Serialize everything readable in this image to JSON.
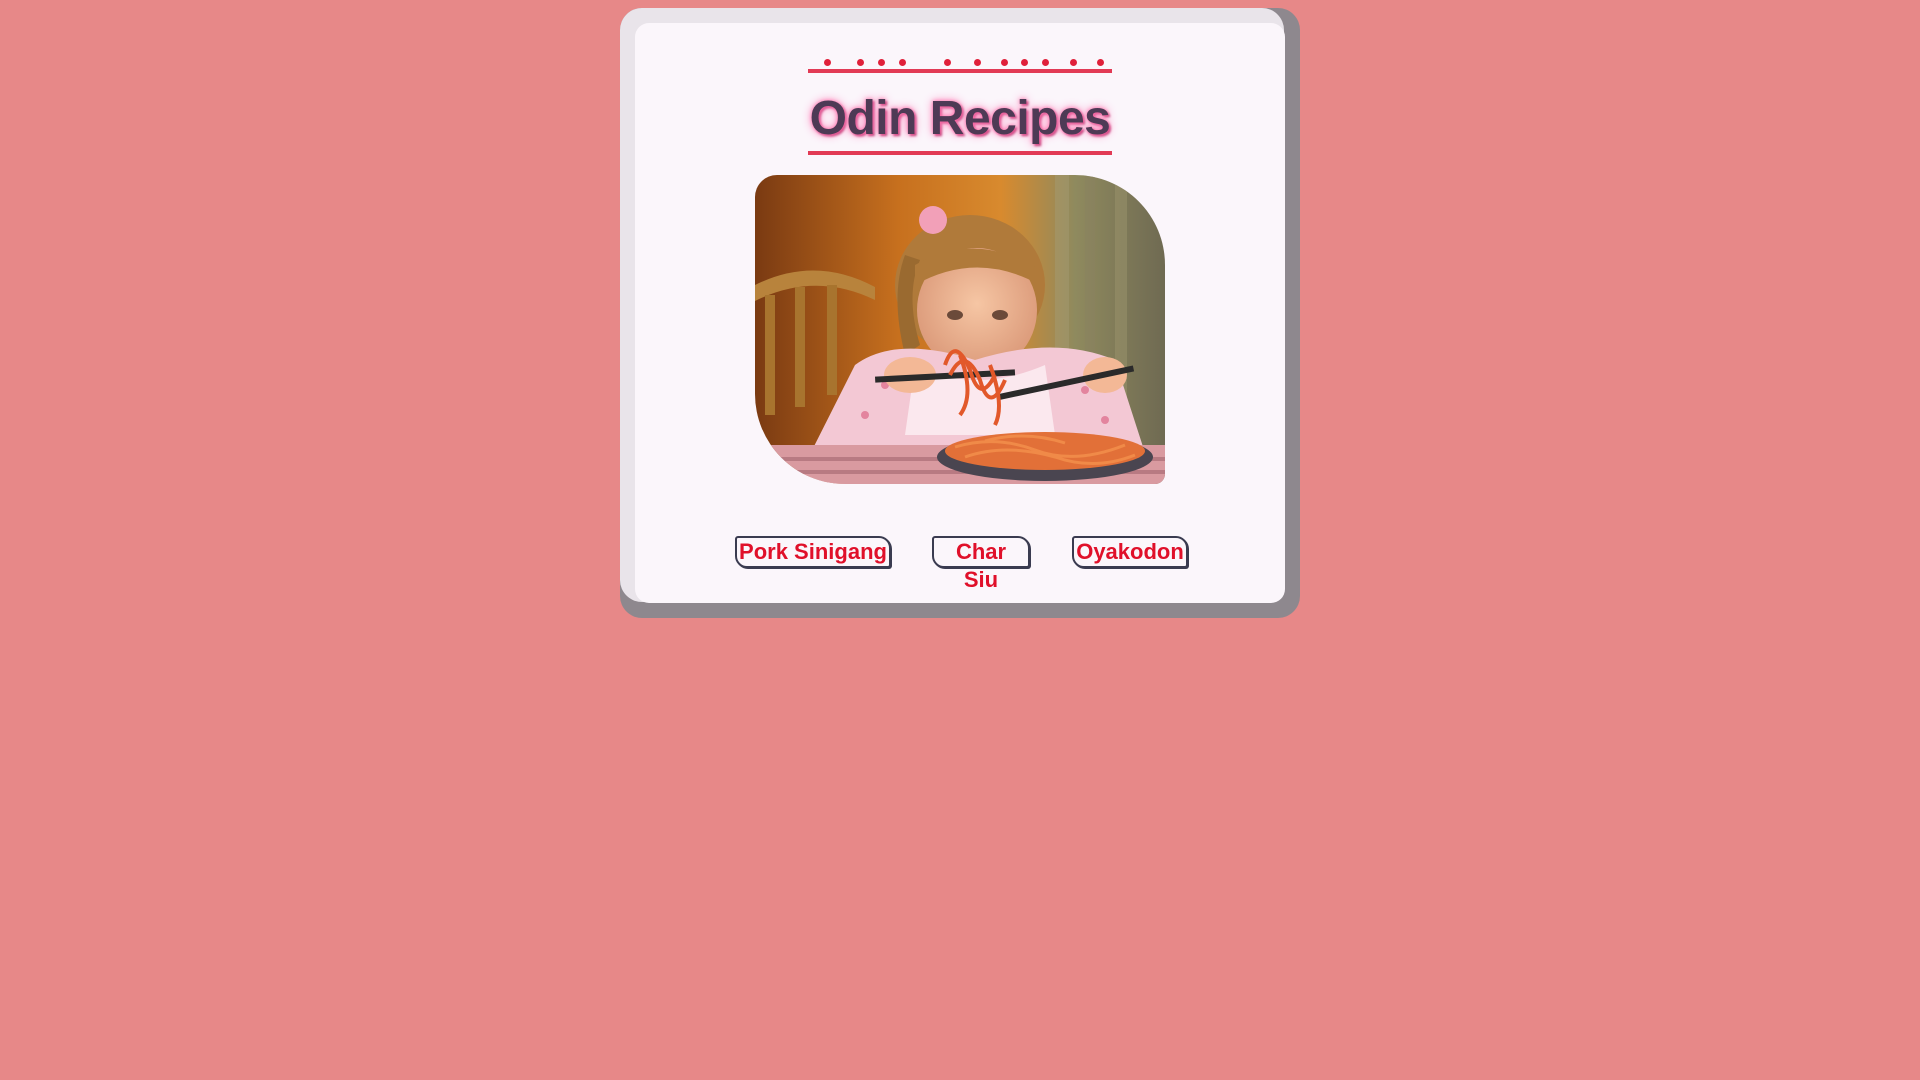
{
  "header": {
    "title": "Odin Recipes"
  },
  "hero": {
    "image_description_icon": "girl-eating-spaghetti-image"
  },
  "nav": {
    "links": [
      {
        "label": "Pork Sinigang"
      },
      {
        "label": "Char Siu"
      },
      {
        "label": "Oyakodon"
      }
    ]
  },
  "colors": {
    "page_background": "#e78888",
    "card_background": "#fbf6fb",
    "accent_red": "#e0102a",
    "title_text": "#4e3a55"
  }
}
